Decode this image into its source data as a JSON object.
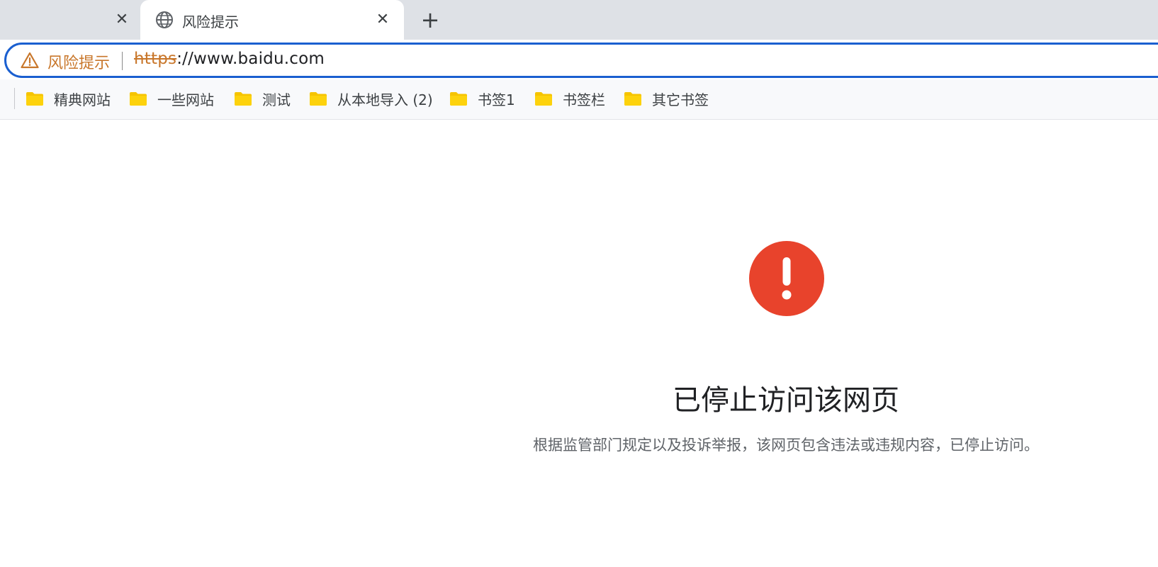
{
  "browser": {
    "tabs": {
      "active_title": "风险提示",
      "close_symbol": "✕",
      "new_tab_symbol": "+"
    },
    "omnibox": {
      "security_label": "风险提示",
      "url_scheme": "https",
      "url_rest": "://www.baidu.com",
      "warning_color": "#c8762a",
      "focus_ring_color": "#1a5fd0"
    },
    "bookmarks": [
      {
        "label": "精典网站",
        "icon": "folder-icon"
      },
      {
        "label": "一些网站",
        "icon": "folder-icon"
      },
      {
        "label": "测试",
        "icon": "folder-icon"
      },
      {
        "label": "从本地导入 (2)",
        "icon": "folder-icon"
      },
      {
        "label": "书签1",
        "icon": "folder-icon"
      },
      {
        "label": "书签栏",
        "icon": "folder-icon"
      },
      {
        "label": "其它书签",
        "icon": "folder-icon"
      }
    ],
    "folder_color": "#f6c400"
  },
  "page": {
    "icon": "exclamation-circle-icon",
    "icon_color": "#e8432c",
    "title": "已停止访问该网页",
    "description": "根据监管部门规定以及投诉举报，该网页包含违法或违规内容，已停止访问。"
  }
}
